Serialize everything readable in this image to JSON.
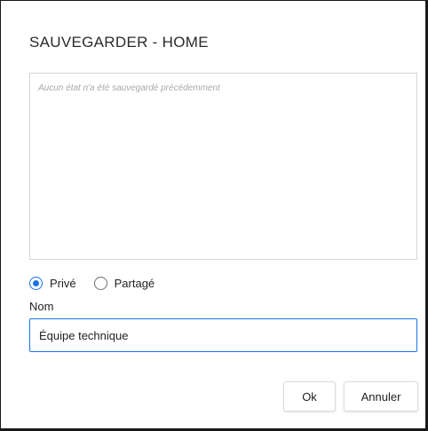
{
  "dialog": {
    "title": "SAUVEGARDER - HOME",
    "empty_message": "Aucun état n'a été sauvegardé précédemment",
    "visibility": {
      "options": [
        {
          "label": "Privé",
          "checked": true
        },
        {
          "label": "Partagé",
          "checked": false
        }
      ]
    },
    "name_label": "Nom",
    "name_value": "Équipe technique",
    "ok_label": "Ok",
    "cancel_label": "Annuler"
  },
  "colors": {
    "accent": "#1a73e8"
  }
}
